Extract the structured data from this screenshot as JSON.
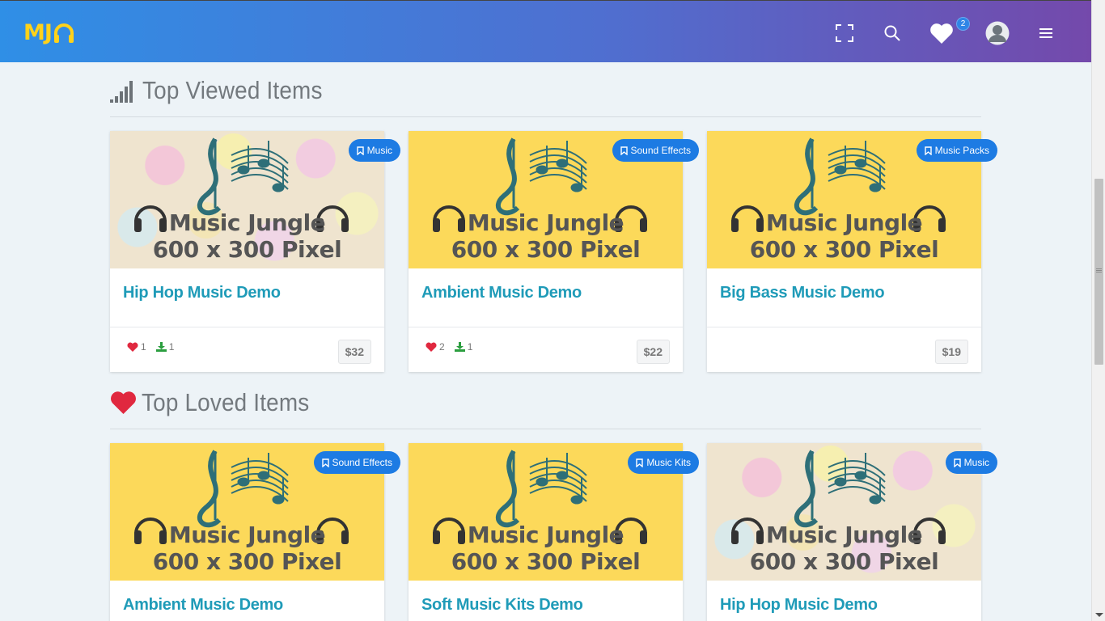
{
  "header": {
    "logo": "MJ",
    "wishlist_count": "2"
  },
  "sections": [
    {
      "title": "Top Viewed Items",
      "cards": [
        {
          "category": "Music",
          "image_line1": "Music Jungle",
          "image_line2": "600 x 300 Pixel",
          "title": "Hip Hop Music Demo",
          "likes": "1",
          "downloads": "1",
          "price": "$32"
        },
        {
          "category": "Sound Effects",
          "image_line1": "Music Jungle",
          "image_line2": "600 x 300 Pixel",
          "title": "Ambient Music Demo",
          "likes": "2",
          "downloads": "1",
          "price": "$22"
        },
        {
          "category": "Music Packs",
          "image_line1": "Music Jungle",
          "image_line2": "600 x 300 Pixel",
          "title": "Big Bass Music Demo",
          "price": "$19"
        }
      ]
    },
    {
      "title": "Top Loved Items",
      "cards": [
        {
          "category": "Sound Effects",
          "image_line1": "Music Jungle",
          "image_line2": "600 x 300 Pixel",
          "title": "Ambient Music Demo"
        },
        {
          "category": "Music Kits",
          "image_line1": "Music Jungle",
          "image_line2": "600 x 300 Pixel",
          "title": "Soft Music Kits Demo"
        },
        {
          "category": "Music",
          "image_line1": "Music Jungle",
          "image_line2": "600 x 300 Pixel",
          "title": "Hip Hop Music Demo"
        }
      ]
    }
  ],
  "colors": {
    "accent": "#1f9bb8",
    "tag": "#1d7be3",
    "heart": "#e0283f",
    "download": "#2b9e3f",
    "logo": "#ffd21a"
  }
}
